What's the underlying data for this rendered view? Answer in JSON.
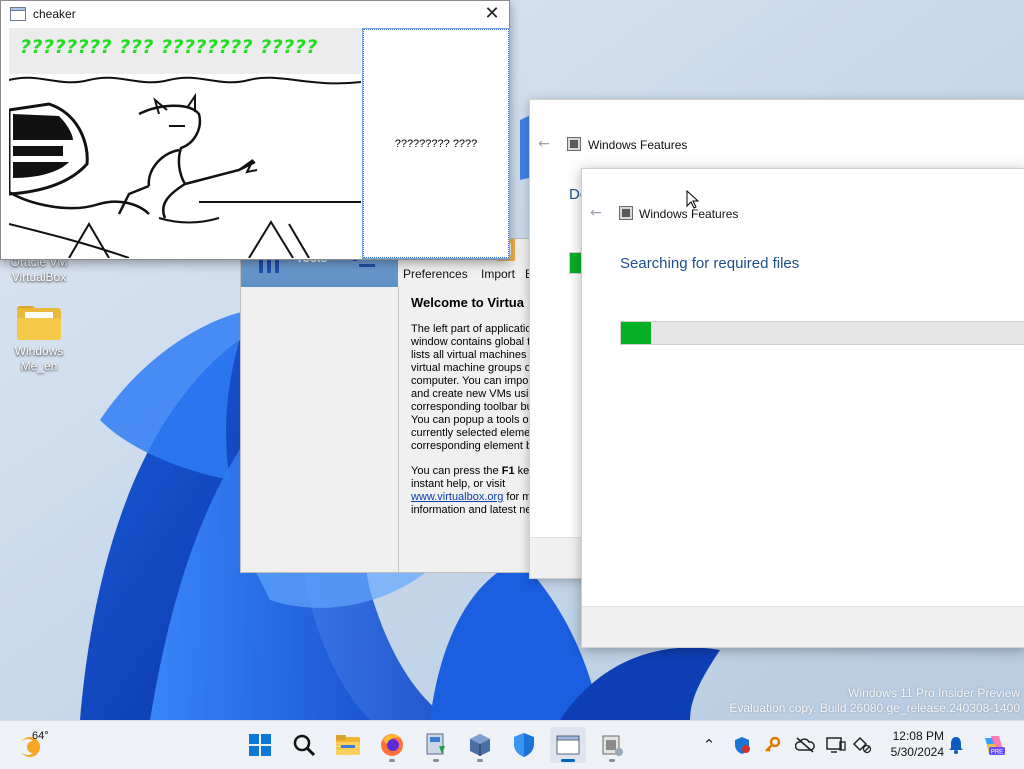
{
  "desktop": {
    "icons": [
      {
        "label_line1": "Oracle VM",
        "label_line2": "VirtualBox"
      },
      {
        "label_line1": "Windows",
        "label_line2": "Me_en"
      }
    ],
    "watermark": {
      "line1": "Windows 11 Pro Insider Preview",
      "line2": "Evaluation copy. Build 26080.ge_release.240308-1400"
    }
  },
  "cheaker": {
    "title": "cheaker",
    "banner_text": "???????? ??? ???????? ?????",
    "button_text": "????????? ????",
    "colors": {
      "banner": "#22dd22"
    }
  },
  "vbox": {
    "tools_label": "Tools",
    "toolbar": [
      "Preferences",
      "Import",
      "E"
    ],
    "welcome": "Welcome to Virtua",
    "paragraph1": "The left part of applicatio\nwindow contains global to\nlists all virtual machines a\nvirtual machine groups on\ncomputer. You can impor\nand create new VMs usin\ncorresponding toolbar bu\nYou can popup a tools of\ncurrently selected elemen\ncorresponding element b",
    "paragraph2_prefix": "You can press the ",
    "paragraph2_key": "F1",
    "paragraph2_suffix": " key",
    "paragraph2_line2": "instant help, or visit",
    "link": "www.virtualbox.org",
    "link_suffix": " for m",
    "paragraph2_line4": "information and latest ne"
  },
  "wf_back": {
    "title": "Windows Features",
    "heading_partial": "Do",
    "progress": 0.03
  },
  "wf_front": {
    "title": "Windows Features",
    "heading": "Searching for required files",
    "progress": 0.075
  },
  "taskbar": {
    "weather_temp": "64°",
    "apps": [
      "start",
      "search",
      "file-explorer",
      "firefox",
      "installer",
      "virtualbox",
      "defender",
      "cheaker",
      "windows-features"
    ],
    "time": "12:08 PM",
    "date": "5/30/2024",
    "colors": {
      "accent": "#0067c0",
      "progress": "#06b025"
    }
  }
}
